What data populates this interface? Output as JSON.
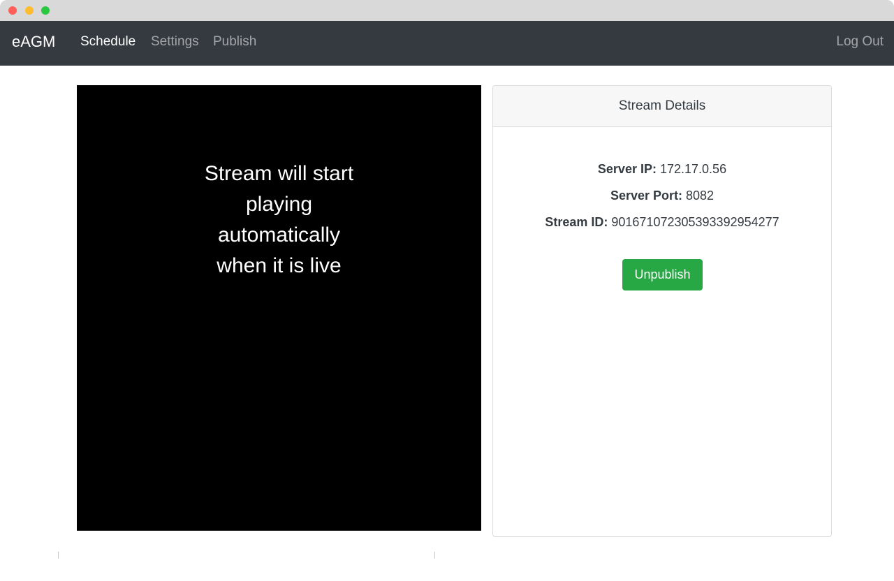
{
  "navbar": {
    "brand": "eAGM",
    "links": [
      "Schedule",
      "Settings",
      "Publish"
    ],
    "logout": "Log Out"
  },
  "player": {
    "message_lines": [
      "Stream will start",
      "playing",
      "automatically",
      "when it is live"
    ]
  },
  "stream_details": {
    "header": "Stream Details",
    "server_ip_label": "Server IP:",
    "server_ip": "172.17.0.56",
    "server_port_label": "Server Port:",
    "server_port": "8082",
    "stream_id_label": "Stream ID:",
    "stream_id": "901671072305393392954277",
    "unpublish_label": "Unpublish"
  },
  "colors": {
    "navbar_bg": "#343a40",
    "button_green": "#28a745"
  }
}
